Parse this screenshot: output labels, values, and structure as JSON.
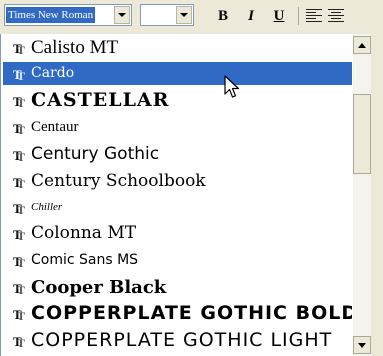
{
  "toolbar": {
    "font_name": "Times New Roman",
    "font_size": "",
    "bold_label": "B",
    "italic_label": "I",
    "underline_label": "U",
    "icons": [
      "chevron-down-icon",
      "align-left-icon",
      "align-center-icon"
    ]
  },
  "font_list": {
    "items": [
      {
        "name": "Calisto MT",
        "selected": false
      },
      {
        "name": "Cardo",
        "selected": true
      },
      {
        "name": "CASTELLAR",
        "selected": false
      },
      {
        "name": "Centaur",
        "selected": false
      },
      {
        "name": "Century Gothic",
        "selected": false
      },
      {
        "name": "Century Schoolbook",
        "selected": false
      },
      {
        "name": "Chiller",
        "selected": false
      },
      {
        "name": "Colonna MT",
        "selected": false
      },
      {
        "name": "Comic Sans MS",
        "selected": false
      },
      {
        "name": "Cooper Black",
        "selected": false
      },
      {
        "name": "COPPERPLATE GOTHIC BOLD",
        "selected": false
      },
      {
        "name": "COPPERPLATE GOTHIC LIGHT",
        "selected": false
      }
    ],
    "item_icon": "truetype-font-icon"
  },
  "colors": {
    "selection": "#316ac5",
    "toolbar_bg": "#ece9d8"
  }
}
